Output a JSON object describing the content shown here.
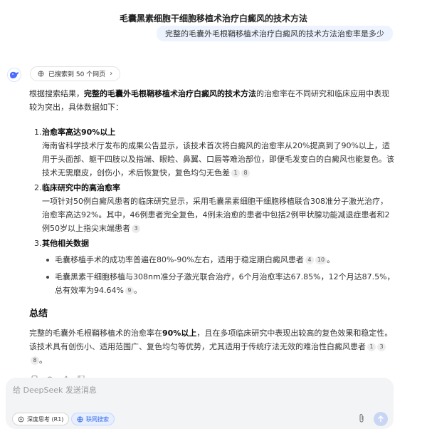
{
  "header": {
    "title": "毛囊黑素细胞干细胞移植术治疗白癜风的技术方法"
  },
  "user_message": "完整的毛囊外毛根鞘移植术治疗白癜风的技术方法治愈率是多少",
  "search_status": {
    "label": "已搜索到 50 个网页",
    "chevron": "›"
  },
  "answer": {
    "intro_a": "根据搜索结果，",
    "intro_b": "完整的毛囊外毛根鞘移植术治疗白癜风的技术方法",
    "intro_c": "的治愈率在不同研究和临床应用中表现较为突出，具体数据如下：",
    "sections": [
      {
        "num": "1.",
        "title": "治愈率高达90%以上",
        "text": "海南省科学技术厅发布的成果公告显示，该技术首次将白癜风的治愈率从20%提高到了90%以上，适用于头面部、躯干四肢以及指端、眼睑、鼻翼、口唇等难治部位，即便毛发变白的白癜风也能复色。该技术无需磨皮，创伤小，术后恢复快，复色均匀无色差",
        "cites": [
          "1",
          "8"
        ]
      },
      {
        "num": "2.",
        "title": "临床研究中的高治愈率",
        "text": "一项针对50例白癜风患者的临床研究显示，采用毛囊黑素细胞干细胞移植联合308准分子激光治疗，治愈率高达92%。其中，46例患者完全复色，4例未治愈的患者中包括2例甲状腺功能减退症患者和2例50岁以上指尖末端患者",
        "cites": [
          "3"
        ]
      },
      {
        "num": "3.",
        "title": "其他相关数据",
        "bullets": [
          {
            "text": "毛囊移植手术的成功率普遍在80%-90%左右，适用于稳定期白癜风患者",
            "cites": [
              "4",
              "10"
            ],
            "tail": "。"
          },
          {
            "text": "毛囊黑素干细胞移植与308nm准分子激光联合治疗，6个月治愈率达67.85%，12个月达87.5%，总有效率为94.64%",
            "cites": [
              "9"
            ],
            "tail": "。"
          }
        ]
      }
    ],
    "summary_heading": "总结",
    "summary_a": "完整的毛囊外毛根鞘移植术的治愈率在",
    "summary_b": "90%以上",
    "summary_c": "，且在多项临床研究中表现出较高的复色效果和稳定性。该技术具有创伤小、适用范围广、复色均匀等优势，尤其适用于传统疗法无效的难治性白癜风患者",
    "summary_cites": [
      "1",
      "3",
      "8"
    ],
    "summary_tail": "。"
  },
  "composer": {
    "placeholder": "给 DeepSeek 发送消息",
    "deep_think_label": "深度思考 (R1)",
    "web_search_label": "联网搜索"
  },
  "colors": {
    "accent": "#4d6bfe",
    "user_bubble": "#eef4ff",
    "composer_bg": "#f3f4f6"
  },
  "icons": [
    "deepseek-whale-icon",
    "copy-icon",
    "regenerate-icon",
    "thumbs-up-icon",
    "thumbs-down-icon",
    "think-icon",
    "globe-icon",
    "paperclip-icon",
    "arrow-up-icon"
  ]
}
